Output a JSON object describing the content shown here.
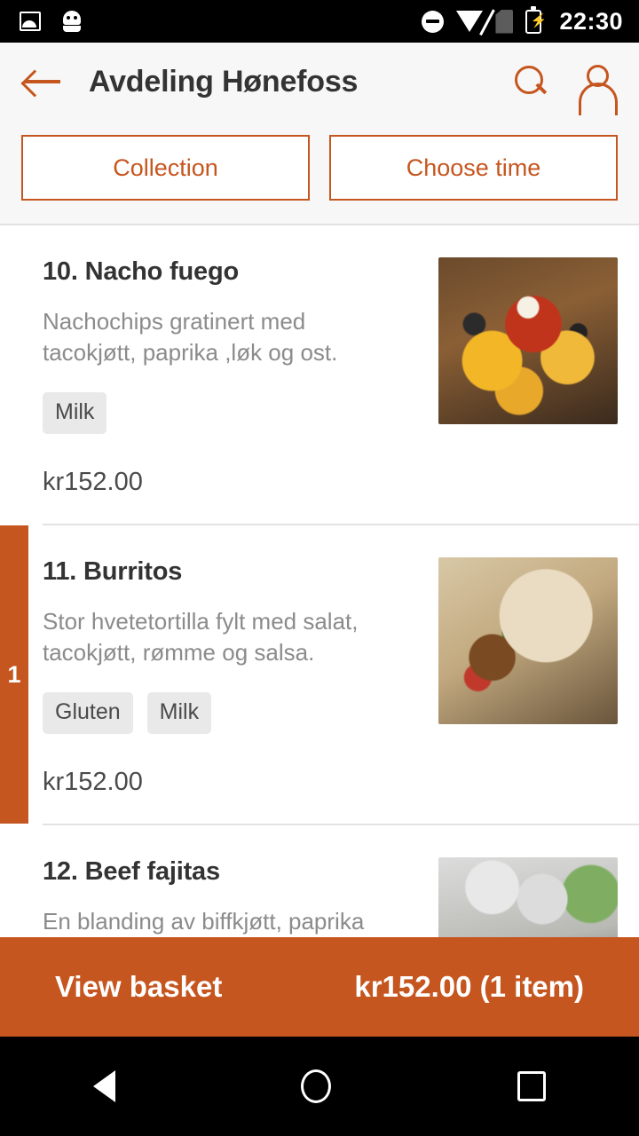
{
  "status_bar": {
    "time": "22:30",
    "left_icons": [
      "photo-icon",
      "android-robot-icon"
    ],
    "right_icons": [
      "do-not-disturb-icon",
      "wifi-icon",
      "no-sim-icon",
      "battery-charging-icon"
    ]
  },
  "app_bar": {
    "title": "Avdeling Hønefoss",
    "back_icon": "back-arrow-icon",
    "search_icon": "search-icon",
    "account_icon": "user-account-icon"
  },
  "fulfilment": {
    "collection_label": "Collection",
    "time_label": "Choose time"
  },
  "theme": {
    "accent": "#c6561f",
    "tag_background": "#e9e9e9",
    "header_background": "#f7f7f7"
  },
  "menu": {
    "items": [
      {
        "title": "10. Nacho fuego",
        "description": "Nachochips gratinert med tacokjøtt, paprika ,løk og ost.",
        "tags": [
          "Milk"
        ],
        "price": "kr152.00",
        "quantity": "",
        "image": "nachos-photo"
      },
      {
        "title": "11. Burritos",
        "description": "Stor hvetetortilla fylt med salat, tacokjøtt, rømme og salsa.",
        "tags": [
          "Gluten",
          "Milk"
        ],
        "price": "kr152.00",
        "quantity": "1",
        "image": "burrito-photo"
      },
      {
        "title": "12. Beef fajitas",
        "description": "En blanding av biffkjøtt, paprika og",
        "tags": [],
        "price": "",
        "quantity": "",
        "image": "fajitas-photo"
      }
    ]
  },
  "basket": {
    "label": "View basket",
    "total": "kr152.00 (1 item)"
  },
  "nav_bar": {
    "back": "nav-back-icon",
    "home": "nav-home-icon",
    "recents": "nav-recents-icon"
  }
}
